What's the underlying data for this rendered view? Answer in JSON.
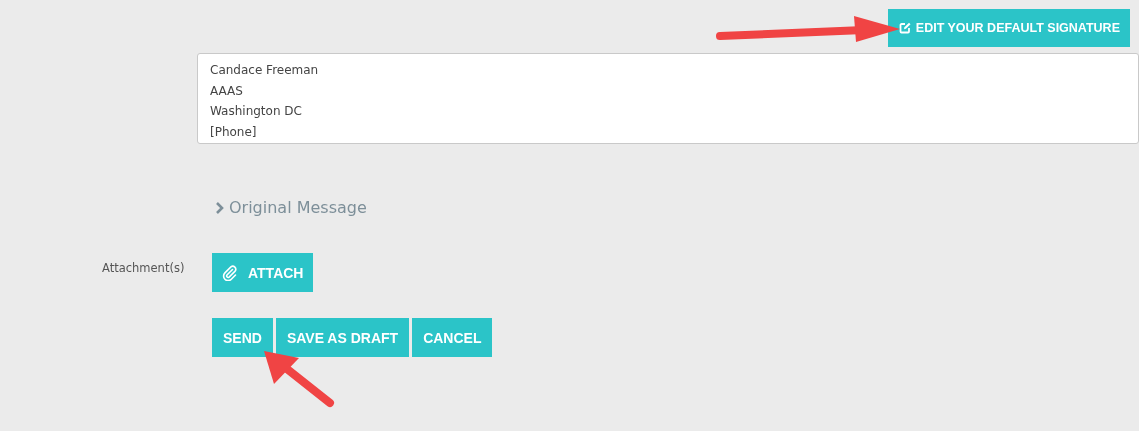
{
  "signature_button": {
    "label": "EDIT YOUR DEFAULT SIGNATURE"
  },
  "signature": {
    "lines": [
      "Candace Freeman",
      "AAAS",
      "Washington DC",
      "[Phone]"
    ]
  },
  "original_message": {
    "label": "Original Message",
    "expanded": false
  },
  "attachments": {
    "label": "Attachment(s)",
    "button": "ATTACH"
  },
  "actions": [
    "SEND",
    "SAVE AS DRAFT",
    "CANCEL"
  ]
}
